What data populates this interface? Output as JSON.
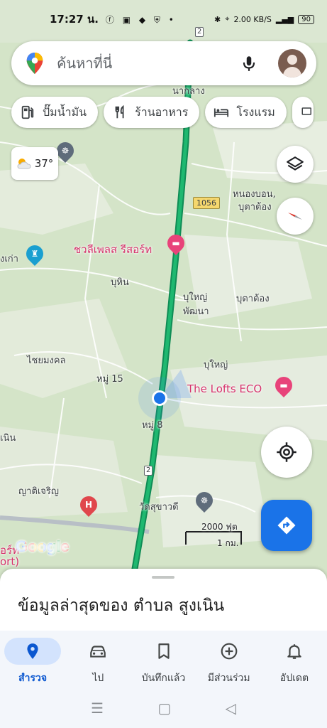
{
  "status_bar": {
    "time": "17:27 น.",
    "battery": "90",
    "net_speed": "2.00 KB/S"
  },
  "search": {
    "placeholder": "ค้นหาที่นี่"
  },
  "chips": [
    {
      "label": "ปั๊มน้ำมัน",
      "icon": "gas-station-icon"
    },
    {
      "label": "ร้านอาหาร",
      "icon": "restaurant-icon"
    },
    {
      "label": "โรงแรม",
      "icon": "hotel-icon"
    }
  ],
  "weather": {
    "temperature": "37°",
    "icon": "partly-cloudy-icon"
  },
  "map": {
    "labels": {
      "nakhlang": "นากลาง",
      "nongbon": "หนองบอน,",
      "butatong1": "บุตาต้อง",
      "chalee": "ชวลีเพลส รีสอร์ท",
      "kao": "งเก่า",
      "buhin": "บุหิน",
      "buyai_phatthana1": "บุใหญ่",
      "buyai_phatthana2": "พัฒนา",
      "butatong2": "บุตาต้อง",
      "chaimongkhon": "ไชยมงคล",
      "moo15": "หมู่ 15",
      "buyai": "บุใหญ่",
      "lofts": "The Lofts ECO",
      "moo8": "หมู่ 8",
      "noen": "เนิน",
      "yatijaroen": "ญาติเจริญ",
      "wat": "วัดสุขาวดี",
      "resort_left1": "อร์ท",
      "resort_left2": "ort)"
    },
    "route_1056": "1056",
    "route_2_top": "2",
    "route_2_bottom": "2",
    "scale_ft": "2000 ฟุต",
    "scale_km": "1 กม."
  },
  "google_logo": "Google",
  "sheet": {
    "title": "ข้อมูลล่าสุดของ ตำบล สูงเนิน"
  },
  "bottom_nav": [
    {
      "label": "สำรวจ",
      "icon": "explore-pin-icon",
      "active": true
    },
    {
      "label": "ไป",
      "icon": "car-icon",
      "active": false
    },
    {
      "label": "บันทึกแล้ว",
      "icon": "bookmark-icon",
      "active": false
    },
    {
      "label": "มีส่วนร่วม",
      "icon": "add-circle-icon",
      "active": false
    },
    {
      "label": "อัปเดต",
      "icon": "bell-icon",
      "active": false
    }
  ],
  "colors": {
    "accent": "#1a73e8",
    "highway": "#14a362",
    "poi_pink": "#d6336c",
    "map_green": "#d4e4c8"
  }
}
